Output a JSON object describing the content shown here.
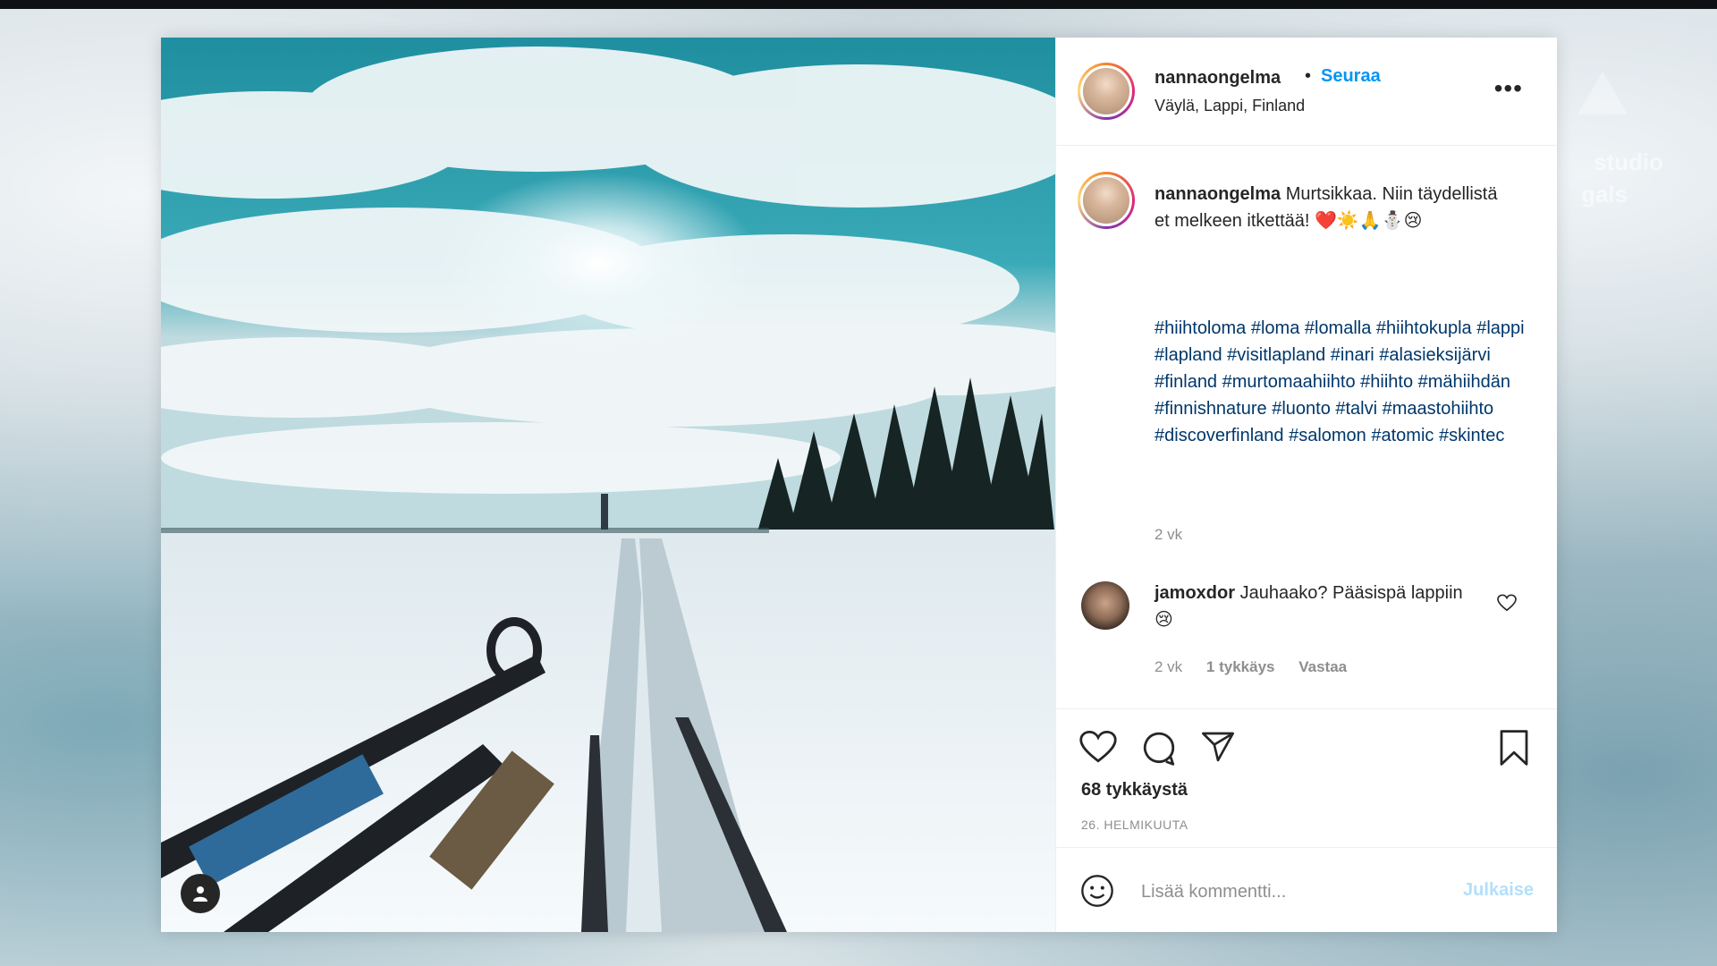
{
  "post": {
    "username": "nannaongelma",
    "separator": "•",
    "follow_label": "Seuraa",
    "location": "Väylä, Lappi, Finland",
    "more_icon": "more-options-icon",
    "caption_text": "Murtsikkaa. Niin täydellistä et melkeen itkettää! ❤️☀️🙏⛄😢",
    "hashtags": "#hiihtoloma #loma #lomalla #hiihtokupla #lappi #lapland #visitlapland #inari #alasieksijärvi #finland #murtomaahiihto #hiihto #mähiihdän #finnishnature #luonto #talvi #maastohiihto #discoverfinland #salomon #atomic #skintec",
    "time": "2 vk"
  },
  "comment": {
    "username": "jamoxdor",
    "text": "Jauhaako? Pääsispä lappiin 😢",
    "time": "2 vk",
    "likes": "1 tykkäys",
    "reply": "Vastaa"
  },
  "actions": {
    "like_count": "68 tykkäystä",
    "date": "26. HELMIKUUTA"
  },
  "add_comment": {
    "placeholder": "Lisää kommentti...",
    "post_button": "Julkaise"
  },
  "watermark": {
    "line1": "studio",
    "line2": "gals"
  },
  "colors": {
    "accent": "#0095f6",
    "link": "#00376b",
    "muted": "#8e8e8e"
  }
}
